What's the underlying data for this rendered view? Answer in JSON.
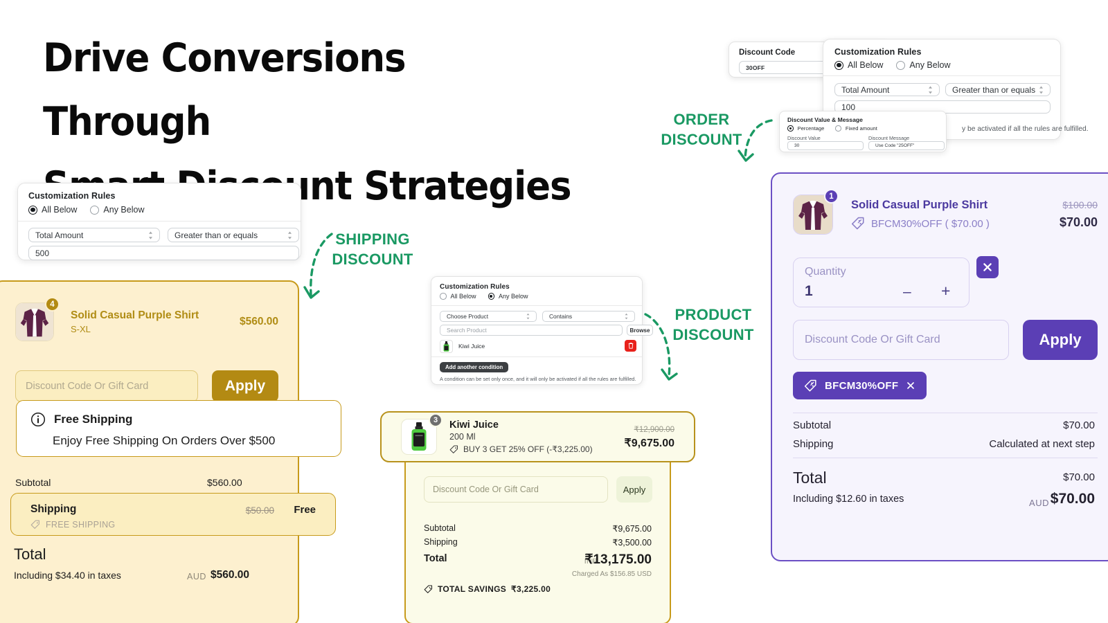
{
  "headline": {
    "line1": "Drive Conversions Through",
    "line2": "Smart Discount Strategies"
  },
  "annotations": {
    "shipping": "SHIPPING\nDISCOUNT",
    "shipping_l1": "SHIPPING",
    "shipping_l2": "DISCOUNT",
    "order_l1": "ORDER",
    "order_l2": "DISCOUNT",
    "product_l1": "PRODUCT",
    "product_l2": "DISCOUNT",
    "color": "#1a9963"
  },
  "discount_code_panel": {
    "label": "Discount Code",
    "value": "30OFF"
  },
  "order_rules_panel": {
    "title": "Customization Rules",
    "option_all": "All Below",
    "option_any": "Any Below",
    "selected": "All Below",
    "condition_field": "Total Amount",
    "operator": "Greater than or equals",
    "value": "100",
    "helper": "A condition can be set only once, and it will only be activated if all the rules are fulfilled.",
    "helper_visible": "y be activated if all the rules are fulfilled."
  },
  "value_message_panel": {
    "title": "Discount Value & Message",
    "option_percentage": "Percentage",
    "option_fixed": "Fixed amount",
    "selected": "Percentage",
    "value_label": "Discount Value",
    "value": "30",
    "message_label": "Discount Message",
    "message": "Use Code \"25OFF\""
  },
  "shipping_rules_panel": {
    "title": "Customization Rules",
    "option_all": "All Below",
    "option_any": "Any Below",
    "selected": "All Below",
    "condition_field": "Total Amount",
    "operator": "Greater than or equals",
    "value": "500"
  },
  "product_rules_panel": {
    "title": "Customization Rules",
    "option_all": "All Below",
    "option_any": "Any Below",
    "selected": "Any Below",
    "condition_field": "Choose Product",
    "operator": "Contains",
    "search_placeholder": "Search Product",
    "browse_label": "Browse",
    "product_name": "Kiwi Juice",
    "add_condition_label": "Add another condition",
    "helper": "A condition can be set only once, and it will only be activated if all the rules are fulfilled."
  },
  "shipping_cart": {
    "item": {
      "qty_badge": "4",
      "title": "Solid Casual Purple Shirt",
      "variant": "S-XL",
      "price": "$560.00"
    },
    "discount_placeholder": "Discount Code Or Gift Card",
    "apply_label": "Apply",
    "free_shipping_title": "Free Shipping",
    "free_shipping_body": "Enjoy Free Shipping On Orders Over $500",
    "subtotal_label": "Subtotal",
    "subtotal_value": "$560.00",
    "shipping_label": "Shipping",
    "shipping_original": "$50.00",
    "shipping_value": "Free",
    "shipping_tag": "FREE SHIPPING",
    "total_label": "Total",
    "tax_note": "Including $34.40 in taxes",
    "currency": "AUD",
    "total_value": "$560.00"
  },
  "product_inr_cart": {
    "item": {
      "qty_badge": "3",
      "title": "Kiwi Juice",
      "variant": "200 Ml",
      "deal": "BUY 3 GET 25% OFF (-₹3,225.00)",
      "price_old": "₹12,900.00",
      "price_new": "₹9,675.00"
    },
    "discount_placeholder": "Discount Code Or Gift Card",
    "apply_label": "Apply",
    "subtotal_label": "Subtotal",
    "subtotal_value": "₹9,675.00",
    "shipping_label": "Shipping",
    "shipping_value": "₹3,500.00",
    "total_label": "Total",
    "total_currency": "INR",
    "total_value": "₹13,175.00",
    "charged_as": "Charged As $156.85 USD",
    "savings_label": "TOTAL SAVINGS",
    "savings_value": "₹3,225.00"
  },
  "product_cart": {
    "item": {
      "qty_badge": "1",
      "title": "Solid Casual Purple Shirt",
      "deal": "BFCM30%OFF ( $70.00 )",
      "price_old": "$100.00",
      "price_new": "$70.00"
    },
    "quantity_label": "Quantity",
    "quantity_value": "1",
    "minus_label": "–",
    "plus_label": "+",
    "discount_placeholder": "Discount Code Or Gift Card",
    "apply_label": "Apply",
    "code_chip": "BFCM30%OFF",
    "subtotal_label": "Subtotal",
    "subtotal_value": "$70.00",
    "shipping_label": "Shipping",
    "shipping_value": "Calculated at next step",
    "total_label": "Total",
    "total_small_value": "$70.00",
    "tax_note": "Including $12.60 in taxes",
    "currency": "AUD",
    "total_value": "$70.00"
  },
  "colors": {
    "accent_green": "#1a9963",
    "yellow_border": "#c79a1a",
    "yellow_bg": "#fdf0cf",
    "yellow_btn": "#b38a13",
    "purple": "#5b3fb5",
    "purple_bg": "#f6f4fd",
    "green_bg": "#fbfbe9"
  }
}
